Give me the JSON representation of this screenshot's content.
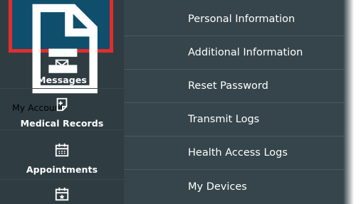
{
  "sidebar": {
    "items": [
      {
        "label": "My Account",
        "icon": "document-icon",
        "selected": true
      },
      {
        "label": "Messages",
        "icon": "envelope-icon"
      },
      {
        "label": "Medical Records",
        "icon": "medical-record-icon"
      },
      {
        "label": "Appointments",
        "icon": "calendar-icon"
      },
      {
        "label": "",
        "icon": "calendar-star-icon"
      }
    ]
  },
  "submenu": {
    "items": [
      {
        "label": "Personal Information"
      },
      {
        "label": "Additional Information"
      },
      {
        "label": "Reset Password"
      },
      {
        "label": "Transmit Logs"
      },
      {
        "label": "Health Access Logs"
      },
      {
        "label": "My Devices"
      }
    ]
  },
  "colors": {
    "sidebar_bg": "#2f3d43",
    "submenu_bg": "#35454b",
    "selected_bg": "#0f4f6c",
    "highlight_border": "#e22d2d",
    "text": "#ffffff"
  }
}
